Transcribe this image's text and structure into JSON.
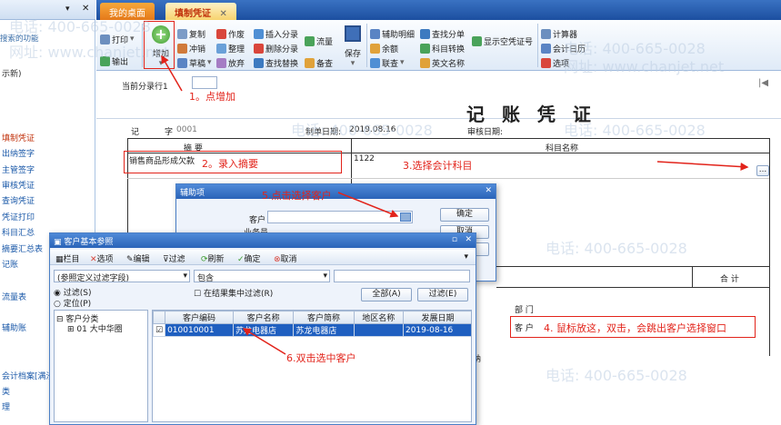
{
  "sidebar": {
    "search_placeholder": "搜索的功能",
    "top_item": "示新)",
    "items": [
      "填制凭证",
      "出纳签字",
      "主管签字",
      "审核凭证",
      "查询凭证",
      "凭证打印",
      "科目汇总",
      "摘要汇总表",
      "记账",
      "流量表",
      "辅助账",
      "会计档案[满汐",
      "类",
      "理"
    ]
  },
  "tabs": [
    {
      "label": "我的桌面"
    },
    {
      "label": "填制凭证"
    }
  ],
  "toolbar": {
    "print": "打印",
    "export": "输出",
    "add": "增加",
    "copy": "复制",
    "offset": "冲销",
    "draft": "草稿",
    "void": "作废",
    "tidy": "整理",
    "jump": "放弃",
    "insert_entry": "插入分录",
    "delete_entry": "删除分录",
    "find_replace": "查找替换",
    "flow": "流量",
    "backup": "备查",
    "save": "保存",
    "aux_detail": "辅助明细",
    "balance": "余额",
    "link": "联查",
    "find_entry": "查找分单",
    "subject_convert": "科目转换",
    "english_name": "英文名称",
    "show_voucher_no": "显示空凭证号",
    "calculator": "计算器",
    "accounting_calendar": "会计日历",
    "options": "选项"
  },
  "voucher": {
    "current_row_label": "当前分录行1",
    "title": "记 账 凭 证",
    "type_label": "记",
    "number_label": "字",
    "number": "0001",
    "date_label": "制单日期:",
    "date": "2019.08.16",
    "audit_date_label": "审核日期:",
    "summary_header": "摘 要",
    "subject_header": "科目名称",
    "summary_value": "销售商品形成欠款",
    "subject_value": "1122",
    "total_label": "合 计",
    "dept_label": "部 门",
    "customer_label": "客 户",
    "note_fragment": "纳"
  },
  "aux_dialog": {
    "title": "辅助项",
    "customer_label": "客户",
    "business_label": "业务员",
    "confirm": "确定",
    "cancel": "取消",
    "aux": "辅助"
  },
  "customer_dialog": {
    "title": "客户基本参照",
    "toolbar": [
      "栏目",
      "选项",
      "编辑",
      "过滤",
      "刷新",
      "确定",
      "取消"
    ],
    "filter_select": "(参照定义过滤字段)",
    "match_select": "包含",
    "radio_filter": "过滤(S)",
    "radio_locate": "定位(P)",
    "checkbox_in_result": "在结果集中过滤(R)",
    "all_button": "全部(A)",
    "filter_button": "过滤(E)",
    "tree_root": "客户分类",
    "tree_child": "01 大中华圈",
    "columns": [
      "客户编码",
      "客户名称",
      "客户简称",
      "地区名称",
      "发展日期"
    ],
    "rows": [
      [
        "010010001",
        "苏龙电器店",
        "苏龙电器店",
        "",
        "2019-08-16"
      ]
    ]
  },
  "annotations": {
    "a1": "1。点增加",
    "a2": "2。录入摘要",
    "a3": "3.选择会计科目",
    "a4": "4. 鼠标放这，双击，会跳出客户选择窗口",
    "a5": "5.点击选择客户",
    "a6": "6.双击选中客户"
  },
  "watermark": {
    "phone": "电话: 400-665-0028",
    "site": "网址: www.chanjet.net"
  },
  "colors": {
    "accent": "#1f5fc0",
    "annotation": "#e2231a",
    "tab_active": "#f7d36f"
  }
}
